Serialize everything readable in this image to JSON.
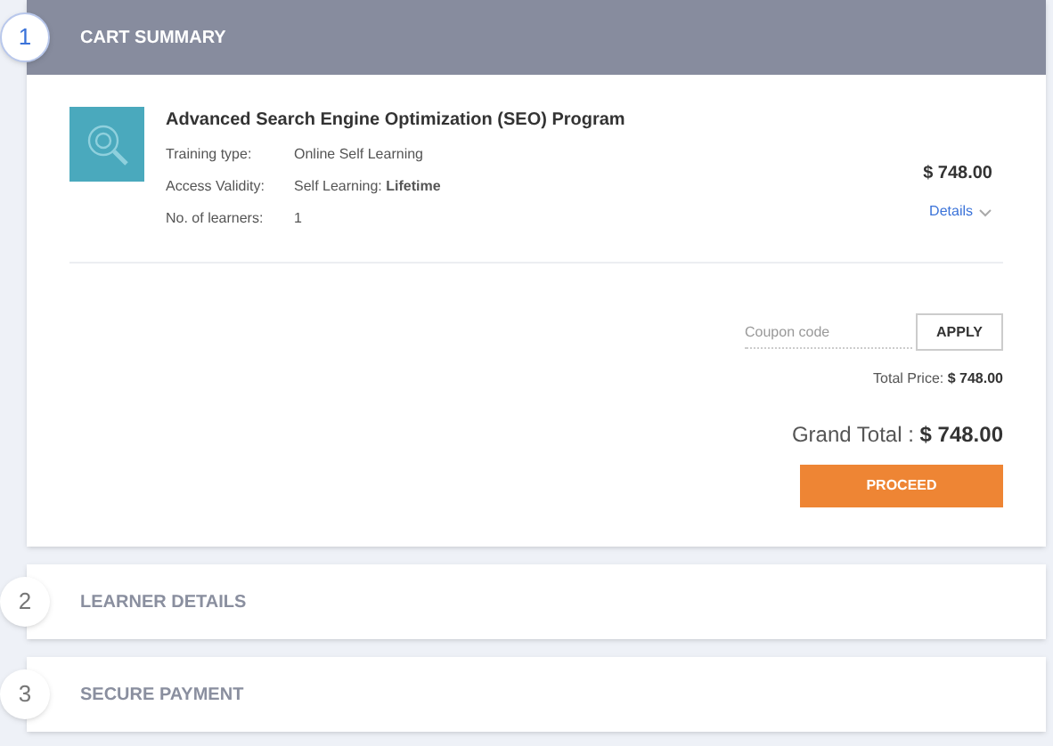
{
  "steps": [
    {
      "number": "1",
      "title": "CART SUMMARY",
      "expanded": true
    },
    {
      "number": "2",
      "title": "LEARNER DETAILS",
      "expanded": false
    },
    {
      "number": "3",
      "title": "SECURE PAYMENT",
      "expanded": false
    }
  ],
  "cart": {
    "product": {
      "name": "Advanced Search Engine Optimization (SEO) Program",
      "details": [
        {
          "label": "Training type:",
          "value": "Online Self Learning"
        },
        {
          "label": "Access Validity:",
          "value": "Self Learning: **Lifetime**"
        },
        {
          "label": "No. of learners:",
          "value": "1"
        }
      ],
      "price": "$ 748.00",
      "details_link": "Details"
    },
    "coupon": {
      "placeholder": "Coupon code",
      "button": "APPLY"
    },
    "total_label": "Total Price:",
    "total_value": "$ 748.00",
    "grand_label": "Grand Total :",
    "grand_value": "$ 748.00",
    "proceed": "PROCEED"
  }
}
